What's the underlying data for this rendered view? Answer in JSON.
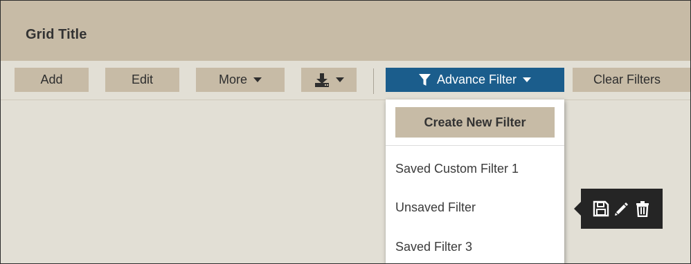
{
  "grid": {
    "title": "Grid Title"
  },
  "toolbar": {
    "add_label": "Add",
    "edit_label": "Edit",
    "more_label": "More",
    "download_icon": "download-icon",
    "advance_filter_label": "Advance Filter",
    "clear_filters_label": "Clear Filters"
  },
  "filter_menu": {
    "create_label": "Create New Filter",
    "items": [
      {
        "label": "Saved Custom Filter 1"
      },
      {
        "label": "Unsaved Filter"
      },
      {
        "label": "Saved Filter 3"
      }
    ]
  },
  "item_actions": {
    "icons": [
      "save-icon",
      "pencil-icon",
      "trash-icon"
    ]
  },
  "colors": {
    "header_bg": "#c7bba6",
    "body_bg": "#e2dfd5",
    "accent": "#1b5d8c",
    "tooltip_bg": "#252525"
  }
}
